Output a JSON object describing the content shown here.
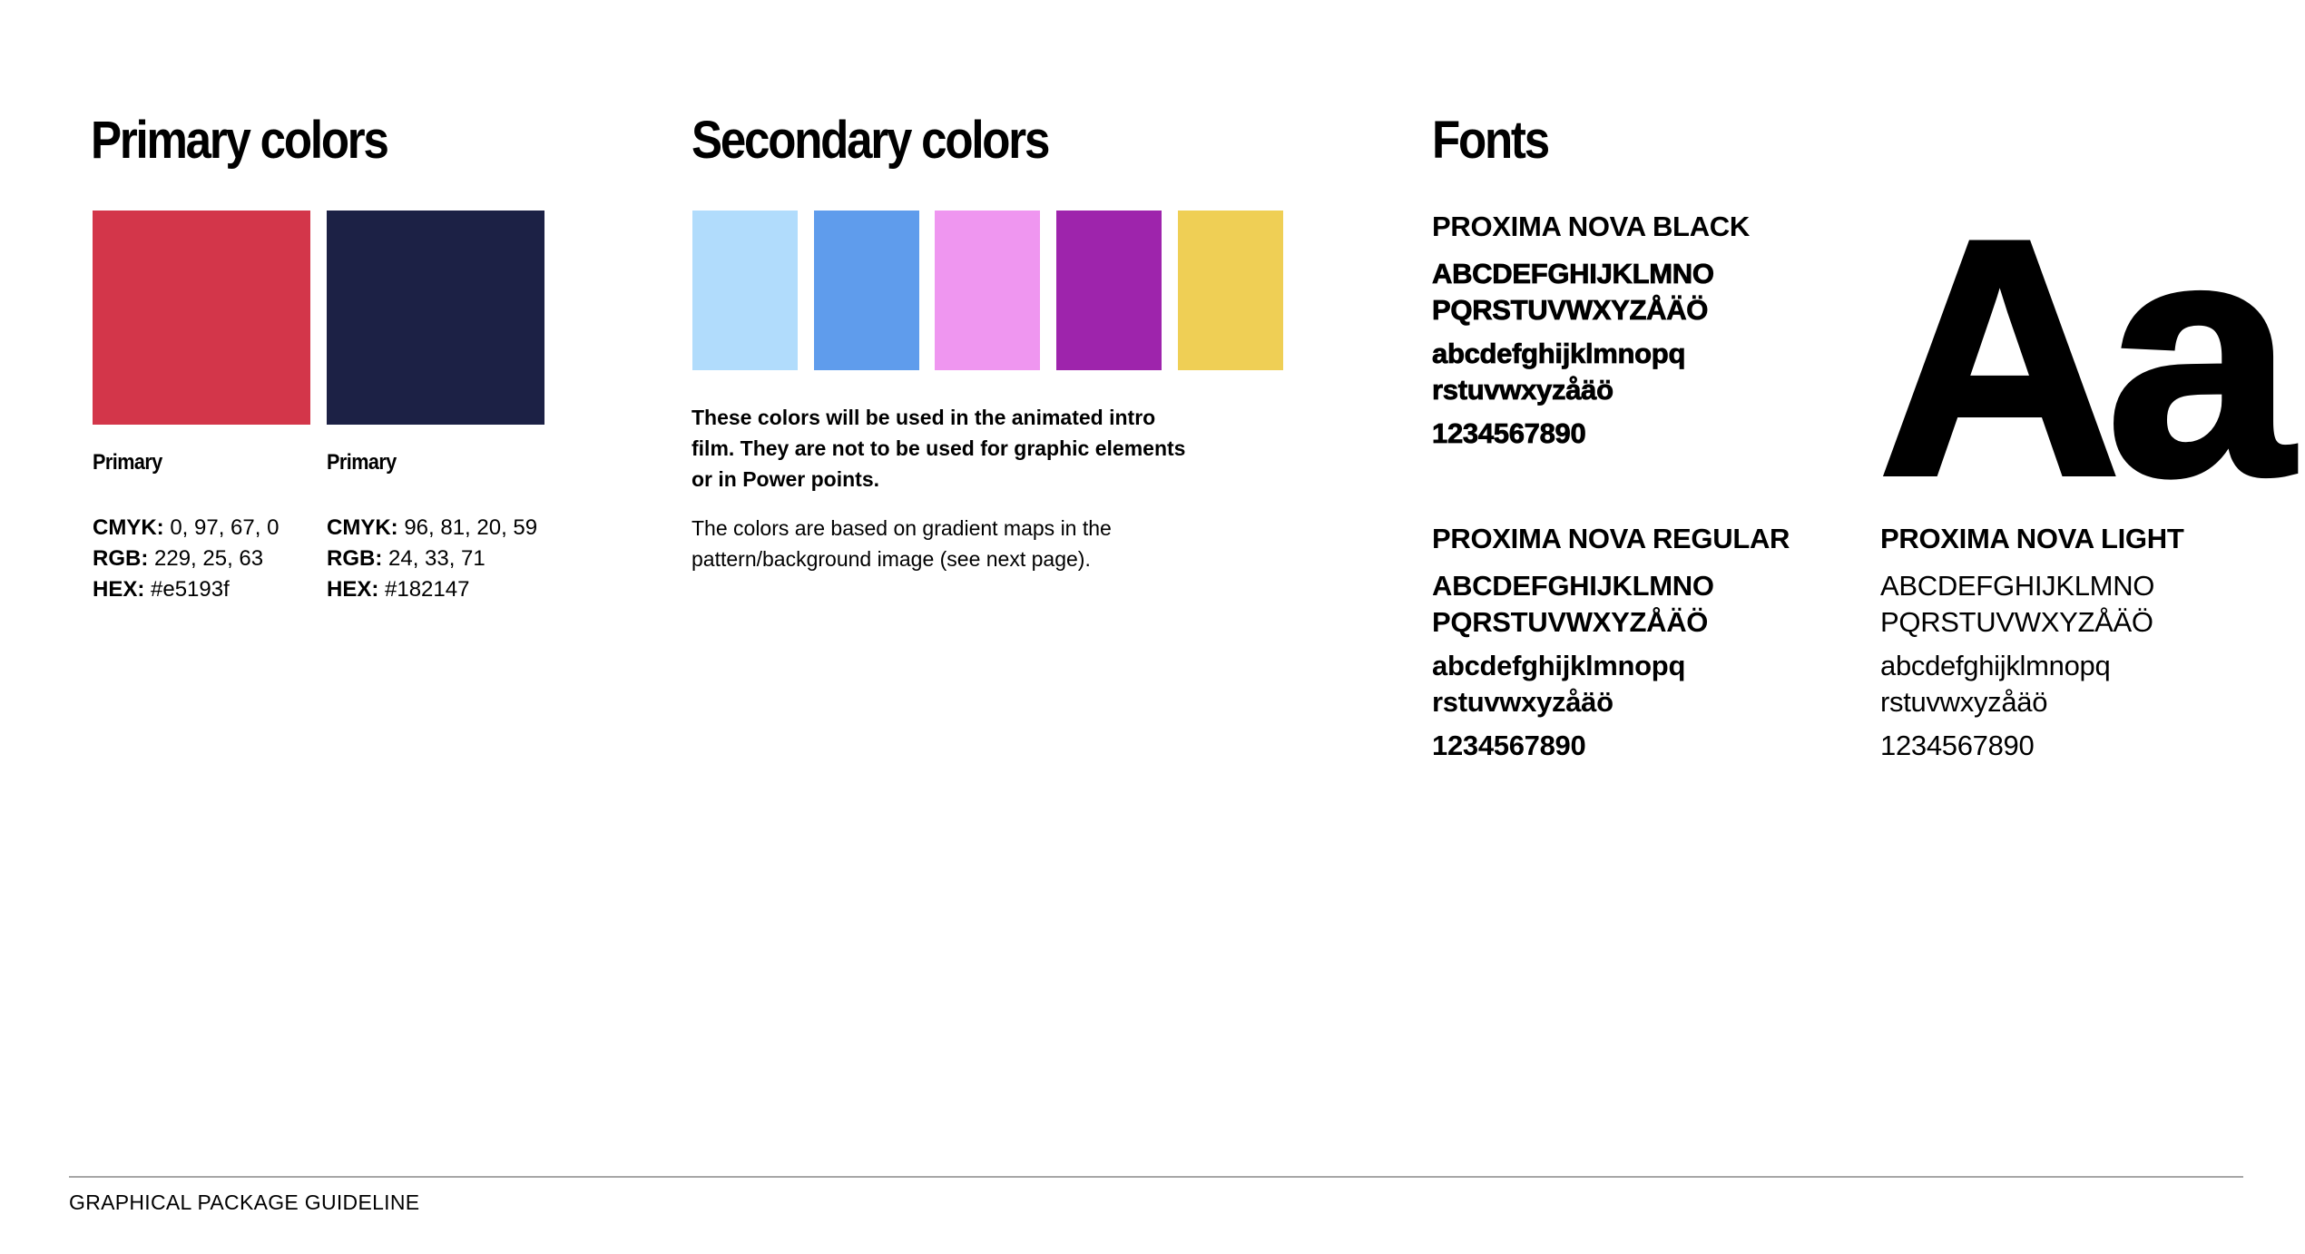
{
  "primary": {
    "heading": "Primary colors",
    "swatches": [
      {
        "label": "Primary",
        "color": "#d3364a",
        "cmyk_label": "CMYK:",
        "cmyk_value": " 0, 97, 67, 0",
        "rgb_label": "RGB:",
        "rgb_value": " 229, 25, 63",
        "hex_label": "HEX:",
        "hex_value": " #e5193f"
      },
      {
        "label": "Primary",
        "color": "#1c2145",
        "cmyk_label": "CMYK:",
        "cmyk_value": " 96, 81, 20, 59",
        "rgb_label": "RGB:",
        "rgb_value": " 24, 33, 71",
        "hex_label": "HEX:",
        "hex_value": " #182147"
      }
    ]
  },
  "secondary": {
    "heading": "Secondary colors",
    "swatches": [
      {
        "color": "#b1dcfc"
      },
      {
        "color": "#5f9cec"
      },
      {
        "color": "#ef96f0"
      },
      {
        "color": "#9e24ac"
      },
      {
        "color": "#efcf55"
      }
    ],
    "note_bold": "These colors will be used in the animated intro film. They are not to be used for graphic elements or in Power points.",
    "note_regular": "The colors are based on gradient maps in the pattern/background image (see next page)."
  },
  "fonts": {
    "heading": "Fonts",
    "samples": [
      {
        "name": "PROXIMA NOVA BLACK",
        "upper_1": "ABCDEFGHIJKLMNO",
        "upper_2": "PQRSTUVWXYZÅÄÖ",
        "lower_1": "abcdefghijklmnopq",
        "lower_2": "rstuvwxyzåäö",
        "digits": "1234567890"
      },
      {
        "name": "PROXIMA NOVA REGULAR",
        "upper_1": "ABCDEFGHIJKLMNO",
        "upper_2": "PQRSTUVWXYZÅÄÖ",
        "lower_1": "abcdefghijklmnopq",
        "lower_2": "rstuvwxyzåäö",
        "digits": "1234567890"
      },
      {
        "name": "PROXIMA NOVA LIGHT",
        "upper_1": "ABCDEFGHIJKLMNO",
        "upper_2": "PQRSTUVWXYZÅÄÖ",
        "lower_1": "abcdefghijklmnopq",
        "lower_2": "rstuvwxyzåäö",
        "digits": "1234567890"
      }
    ],
    "specimen": "Aa"
  },
  "footer": {
    "text": "GRAPHICAL PACKAGE GUIDELINE"
  }
}
